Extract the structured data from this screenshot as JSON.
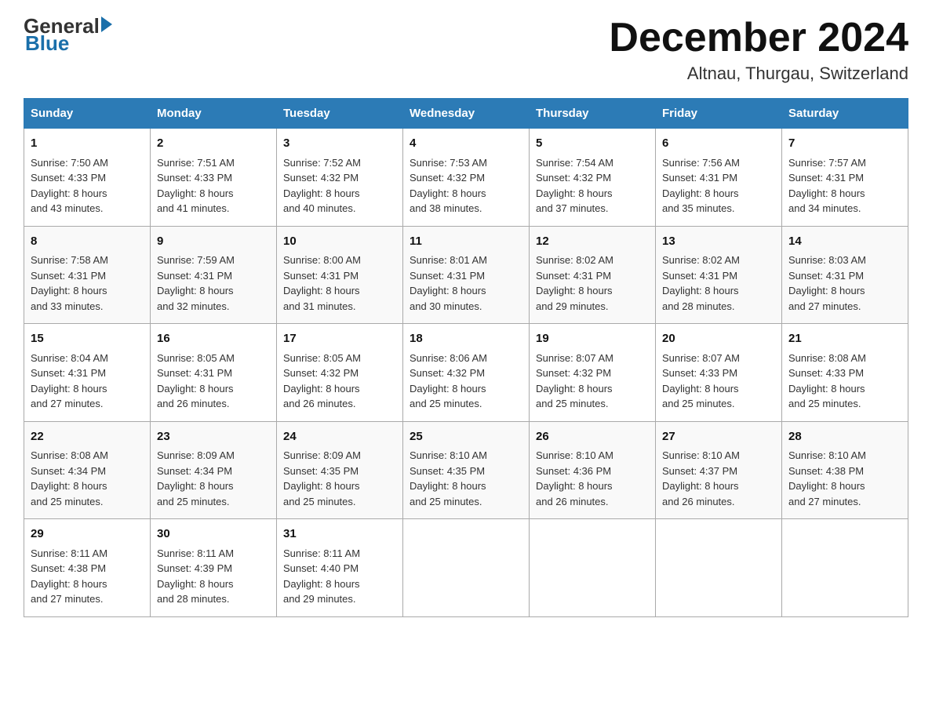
{
  "header": {
    "logo_line1": "General",
    "logo_line2": "Blue",
    "month_title": "December 2024",
    "location": "Altnau, Thurgau, Switzerland"
  },
  "days_of_week": [
    "Sunday",
    "Monday",
    "Tuesday",
    "Wednesday",
    "Thursday",
    "Friday",
    "Saturday"
  ],
  "weeks": [
    [
      {
        "day": "1",
        "sunrise": "7:50 AM",
        "sunset": "4:33 PM",
        "daylight": "8 hours and 43 minutes."
      },
      {
        "day": "2",
        "sunrise": "7:51 AM",
        "sunset": "4:33 PM",
        "daylight": "8 hours and 41 minutes."
      },
      {
        "day": "3",
        "sunrise": "7:52 AM",
        "sunset": "4:32 PM",
        "daylight": "8 hours and 40 minutes."
      },
      {
        "day": "4",
        "sunrise": "7:53 AM",
        "sunset": "4:32 PM",
        "daylight": "8 hours and 38 minutes."
      },
      {
        "day": "5",
        "sunrise": "7:54 AM",
        "sunset": "4:32 PM",
        "daylight": "8 hours and 37 minutes."
      },
      {
        "day": "6",
        "sunrise": "7:56 AM",
        "sunset": "4:31 PM",
        "daylight": "8 hours and 35 minutes."
      },
      {
        "day": "7",
        "sunrise": "7:57 AM",
        "sunset": "4:31 PM",
        "daylight": "8 hours and 34 minutes."
      }
    ],
    [
      {
        "day": "8",
        "sunrise": "7:58 AM",
        "sunset": "4:31 PM",
        "daylight": "8 hours and 33 minutes."
      },
      {
        "day": "9",
        "sunrise": "7:59 AM",
        "sunset": "4:31 PM",
        "daylight": "8 hours and 32 minutes."
      },
      {
        "day": "10",
        "sunrise": "8:00 AM",
        "sunset": "4:31 PM",
        "daylight": "8 hours and 31 minutes."
      },
      {
        "day": "11",
        "sunrise": "8:01 AM",
        "sunset": "4:31 PM",
        "daylight": "8 hours and 30 minutes."
      },
      {
        "day": "12",
        "sunrise": "8:02 AM",
        "sunset": "4:31 PM",
        "daylight": "8 hours and 29 minutes."
      },
      {
        "day": "13",
        "sunrise": "8:02 AM",
        "sunset": "4:31 PM",
        "daylight": "8 hours and 28 minutes."
      },
      {
        "day": "14",
        "sunrise": "8:03 AM",
        "sunset": "4:31 PM",
        "daylight": "8 hours and 27 minutes."
      }
    ],
    [
      {
        "day": "15",
        "sunrise": "8:04 AM",
        "sunset": "4:31 PM",
        "daylight": "8 hours and 27 minutes."
      },
      {
        "day": "16",
        "sunrise": "8:05 AM",
        "sunset": "4:31 PM",
        "daylight": "8 hours and 26 minutes."
      },
      {
        "day": "17",
        "sunrise": "8:05 AM",
        "sunset": "4:32 PM",
        "daylight": "8 hours and 26 minutes."
      },
      {
        "day": "18",
        "sunrise": "8:06 AM",
        "sunset": "4:32 PM",
        "daylight": "8 hours and 25 minutes."
      },
      {
        "day": "19",
        "sunrise": "8:07 AM",
        "sunset": "4:32 PM",
        "daylight": "8 hours and 25 minutes."
      },
      {
        "day": "20",
        "sunrise": "8:07 AM",
        "sunset": "4:33 PM",
        "daylight": "8 hours and 25 minutes."
      },
      {
        "day": "21",
        "sunrise": "8:08 AM",
        "sunset": "4:33 PM",
        "daylight": "8 hours and 25 minutes."
      }
    ],
    [
      {
        "day": "22",
        "sunrise": "8:08 AM",
        "sunset": "4:34 PM",
        "daylight": "8 hours and 25 minutes."
      },
      {
        "day": "23",
        "sunrise": "8:09 AM",
        "sunset": "4:34 PM",
        "daylight": "8 hours and 25 minutes."
      },
      {
        "day": "24",
        "sunrise": "8:09 AM",
        "sunset": "4:35 PM",
        "daylight": "8 hours and 25 minutes."
      },
      {
        "day": "25",
        "sunrise": "8:10 AM",
        "sunset": "4:35 PM",
        "daylight": "8 hours and 25 minutes."
      },
      {
        "day": "26",
        "sunrise": "8:10 AM",
        "sunset": "4:36 PM",
        "daylight": "8 hours and 26 minutes."
      },
      {
        "day": "27",
        "sunrise": "8:10 AM",
        "sunset": "4:37 PM",
        "daylight": "8 hours and 26 minutes."
      },
      {
        "day": "28",
        "sunrise": "8:10 AM",
        "sunset": "4:38 PM",
        "daylight": "8 hours and 27 minutes."
      }
    ],
    [
      {
        "day": "29",
        "sunrise": "8:11 AM",
        "sunset": "4:38 PM",
        "daylight": "8 hours and 27 minutes."
      },
      {
        "day": "30",
        "sunrise": "8:11 AM",
        "sunset": "4:39 PM",
        "daylight": "8 hours and 28 minutes."
      },
      {
        "day": "31",
        "sunrise": "8:11 AM",
        "sunset": "4:40 PM",
        "daylight": "8 hours and 29 minutes."
      },
      null,
      null,
      null,
      null
    ]
  ],
  "labels": {
    "sunrise": "Sunrise:",
    "sunset": "Sunset:",
    "daylight": "Daylight:"
  }
}
